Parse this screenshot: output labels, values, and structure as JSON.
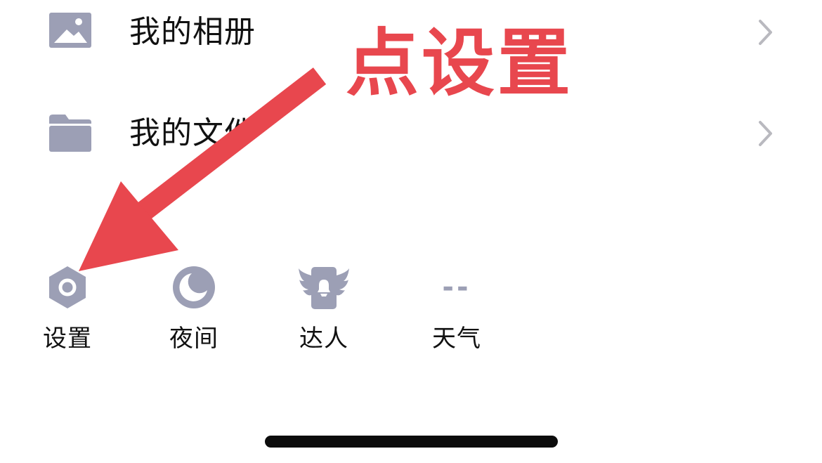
{
  "menu": {
    "items": [
      {
        "label": "我的相册",
        "icon": "photo-album-icon"
      },
      {
        "label": "我的文件",
        "icon": "folder-icon"
      }
    ]
  },
  "shortcuts": [
    {
      "label": "设置",
      "icon": "settings-hexagon-icon"
    },
    {
      "label": "夜间",
      "icon": "night-mode-moon-icon"
    },
    {
      "label": "达人",
      "icon": "winged-badge-icon"
    },
    {
      "label": "天气",
      "value": "--",
      "icon": "weather-placeholder"
    }
  ],
  "annotation": {
    "text": "点设置",
    "color": "#e8474e"
  },
  "colors": {
    "icon_gray": "#9c9fb5",
    "chevron_gray": "#b9b9bf",
    "text": "#111111",
    "background": "#ffffff"
  }
}
